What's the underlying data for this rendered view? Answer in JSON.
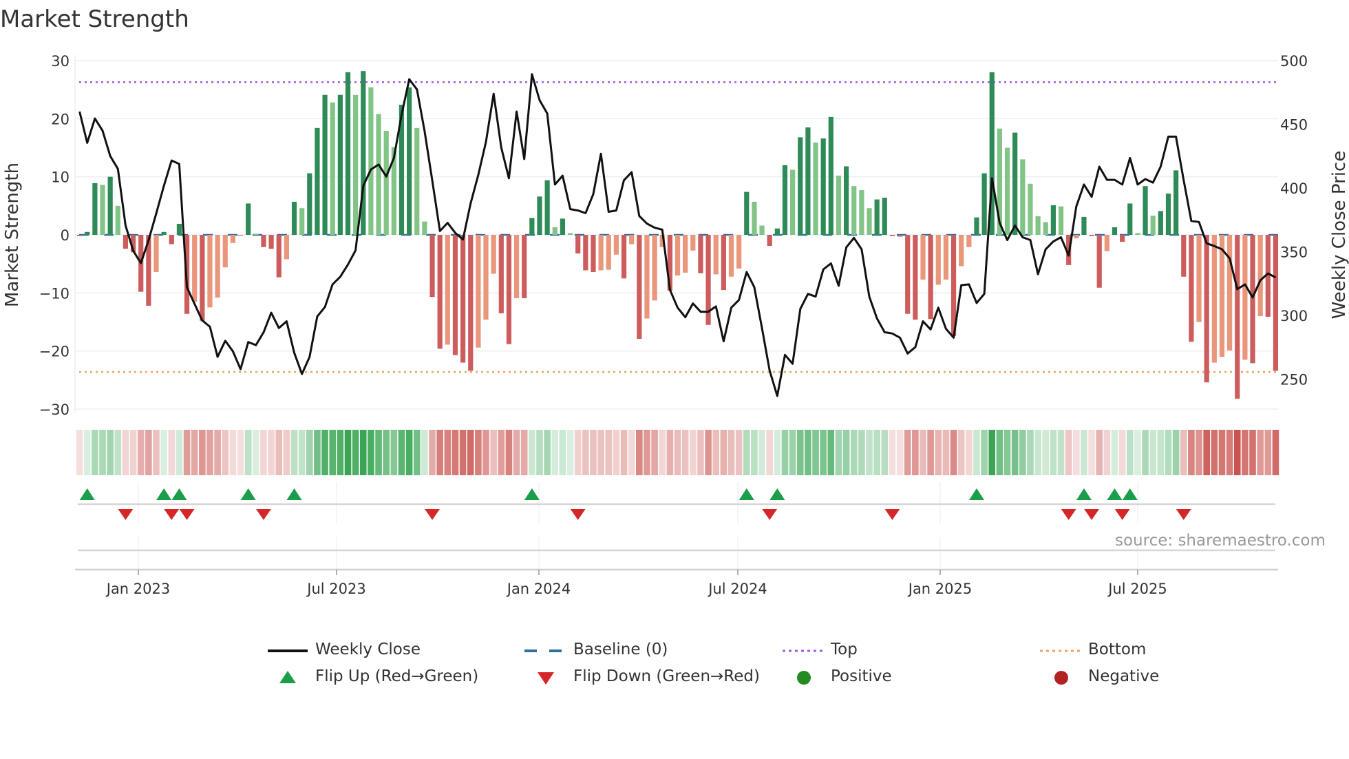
{
  "title": "Market Strength",
  "source": "source: sharemaestro.com",
  "colors": {
    "pos_dark": "#2e8b57",
    "pos_light": "#82c485",
    "neg_dark": "#cd5c5c",
    "neg_light": "#e9967a",
    "price": "#111111",
    "baseline": "#2f6f9f",
    "top": "#9b5de5",
    "bottom": "#f0a35e",
    "flip_up": "#1a9e4a",
    "flip_down": "#d62728",
    "positive": "#228b22",
    "negative": "#b22222",
    "heat_pos": "#3aa655",
    "heat_neg": "#c9544f"
  },
  "legend": {
    "weekly_close": "Weekly Close",
    "baseline": "Baseline (0)",
    "top": "Top",
    "bottom": "Bottom",
    "flip_up": "Flip Up (Red→Green)",
    "flip_down": "Flip Down (Green→Red)",
    "positive": "Positive",
    "negative": "Negative"
  },
  "chart_data": {
    "type": "bar",
    "title": "Market Strength",
    "ylabel": "Market Strength",
    "y2label": "Weekly Close Price",
    "ylim": [
      -30,
      30
    ],
    "y2lim": [
      500,
      250
    ],
    "yticks": [
      "30",
      "20",
      "10",
      "0",
      "−10",
      "−20",
      "−30"
    ],
    "y2ticks": [
      "500",
      "450",
      "400",
      "350",
      "300",
      "250"
    ],
    "xticks": [
      "Jan 2023",
      "Jul 2023",
      "Jan 2024",
      "Jul 2024",
      "Jan 2025",
      "Jul 2025"
    ],
    "top_level": 26.3,
    "bottom_level": -23.6,
    "baseline": 0,
    "frequency": "weekly",
    "strength": [
      -0.2,
      0.5,
      8.9,
      8.6,
      10,
      5,
      -2.4,
      -3,
      -9.8,
      -12.2,
      -6.4,
      0.5,
      -1.6,
      1.9,
      -13.6,
      -11.5,
      -14.8,
      -12.5,
      -10.8,
      -5.6,
      -1.4,
      -0.2,
      5.4,
      0.2,
      -2.1,
      -2.4,
      -7.3,
      -4.2,
      5.7,
      4.6,
      10.6,
      18.4,
      24.1,
      22.8,
      24.1,
      28,
      24.1,
      28.2,
      25.4,
      20.8,
      17.9,
      15.1,
      22.4,
      25.4,
      18.4,
      2.3,
      -10.7,
      -19.6,
      -18.9,
      -20.7,
      -22,
      -23.4,
      -19.4,
      -14.6,
      -6.7,
      -13.5,
      -18.8,
      -10.9,
      -10.9,
      2.9,
      6.6,
      9.4,
      1.3,
      2.8,
      0.3,
      -3.2,
      -6.1,
      -6.4,
      -6.1,
      -6,
      -3.4,
      -7.5,
      -1.6,
      -17.9,
      -14.4,
      -11.3,
      -2.1,
      -9.6,
      -7,
      -6.5,
      -2.7,
      -6.6,
      -15.5,
      -6.8,
      -9.5,
      -7.2,
      -5.8,
      7.4,
      5.7,
      1.6,
      -1.9,
      1.1,
      12,
      11.2,
      16.8,
      18.5,
      15.9,
      16.6,
      20.3,
      10.2,
      11.8,
      8.4,
      7.7,
      4.6,
      6.1,
      6.4,
      -0.2,
      -0.3,
      -13.6,
      -14.6,
      -7.7,
      -14.5,
      -8.6,
      -7.7,
      -17.4,
      -5.4,
      -2.1,
      3,
      10.6,
      28,
      18.3,
      15,
      17.6,
      13,
      8.8,
      3.2,
      2.2,
      5.1,
      4.9,
      -5.2,
      -0.6,
      3.1,
      -0.2,
      -9.1,
      -2.8,
      1.3,
      -1.2,
      5.4,
      0.3,
      8.4,
      3.3,
      4.1,
      7.1,
      11.1,
      -7.2,
      -18.4,
      -15,
      -25.4,
      -22,
      -21,
      -19.9,
      -28.2,
      -21.5,
      -22.1,
      -14,
      -14.1,
      -23.4
    ],
    "weekly_close": [
      460,
      435.4,
      454.5,
      445,
      425,
      415,
      370.6,
      350.6,
      341,
      359,
      380,
      401.6,
      421.6,
      418.8,
      322,
      309,
      296,
      291,
      267.4,
      280,
      271.7,
      257.7,
      279,
      276.6,
      286.7,
      302,
      290,
      295.3,
      270.6,
      253.9,
      267.4,
      299,
      306.5,
      324.3,
      330.3,
      339.8,
      351,
      401.6,
      414.5,
      418.4,
      409,
      423.5,
      457.5,
      485.4,
      477.4,
      444.6,
      406,
      366.2,
      372.6,
      364.7,
      359.5,
      387.7,
      410.2,
      436,
      474,
      431.7,
      407.6,
      460,
      422.7,
      489.3,
      468.9,
      458.5,
      402.7,
      409.6,
      383.4,
      382.3,
      380.2,
      395.2,
      426.8,
      381.3,
      382.3,
      406,
      412.4,
      378,
      372,
      368.8,
      367.3,
      320,
      306,
      298.5,
      309.3,
      302.8,
      302.8,
      307,
      279.6,
      306,
      312,
      334,
      322.2,
      290,
      256.7,
      236.7,
      268.9,
      262,
      305,
      316.8,
      314.7,
      336,
      340.7,
      323.2,
      353.3,
      360.8,
      351.8,
      314.7,
      297.5,
      286.7,
      285.7,
      282.4,
      270,
      275,
      295.3,
      288.9,
      306,
      289.4,
      282.4,
      323.7,
      324.3,
      309.7,
      316.8,
      407.6,
      372.6,
      359.1,
      370.5,
      361.3,
      359.1,
      332.3,
      351.8,
      358,
      361.3,
      346.9,
      385.5,
      402.7,
      393,
      416.7,
      406.4,
      406.4,
      402.7,
      423.5,
      402.7,
      407,
      404.2,
      416.7,
      440.3,
      440.3,
      406,
      374.1,
      373.3,
      356.5,
      354.4,
      351.8,
      344.7,
      320.5,
      324.3,
      314,
      327.5,
      332.9,
      329.7
    ],
    "legend_position": "bottom"
  }
}
